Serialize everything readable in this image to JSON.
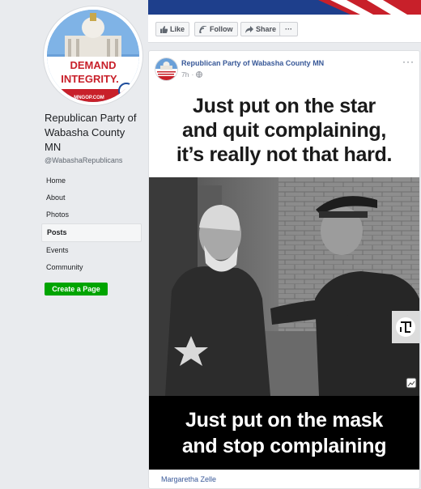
{
  "page": {
    "name": "Republican Party of Wabasha County MN",
    "handle": "@WabashaRepublicans",
    "profile_sign_line1": "DEMAND",
    "profile_sign_line2": "INTEGRITY.",
    "profile_url_fragment": "MNGOP.COM"
  },
  "nav": {
    "items": [
      "Home",
      "About",
      "Photos",
      "Posts",
      "Events",
      "Community"
    ],
    "active": "Posts"
  },
  "create_page_label": "Create a Page",
  "actions": {
    "like": "Like",
    "follow": "Follow",
    "share": "Share",
    "more": "···"
  },
  "post": {
    "author": "Republican Party of Wabasha County MN",
    "time": "7h",
    "separator": "·",
    "more": "···",
    "meme_top_line1": "Just put on the star",
    "meme_top_line2": "and quit complaining,",
    "meme_top_line3": "it’s really not that hard.",
    "meme_bottom_line1": "Just put on the mask",
    "meme_bottom_line2": "and stop complaining",
    "shared_from": "Margaretha Zelle"
  },
  "colors": {
    "link": "#385898",
    "create_button": "#00a400",
    "background": "#e9ebee"
  },
  "icons": [
    "like-icon",
    "follow-icon",
    "share-icon",
    "globe-icon",
    "more-icon",
    "image-icon"
  ]
}
